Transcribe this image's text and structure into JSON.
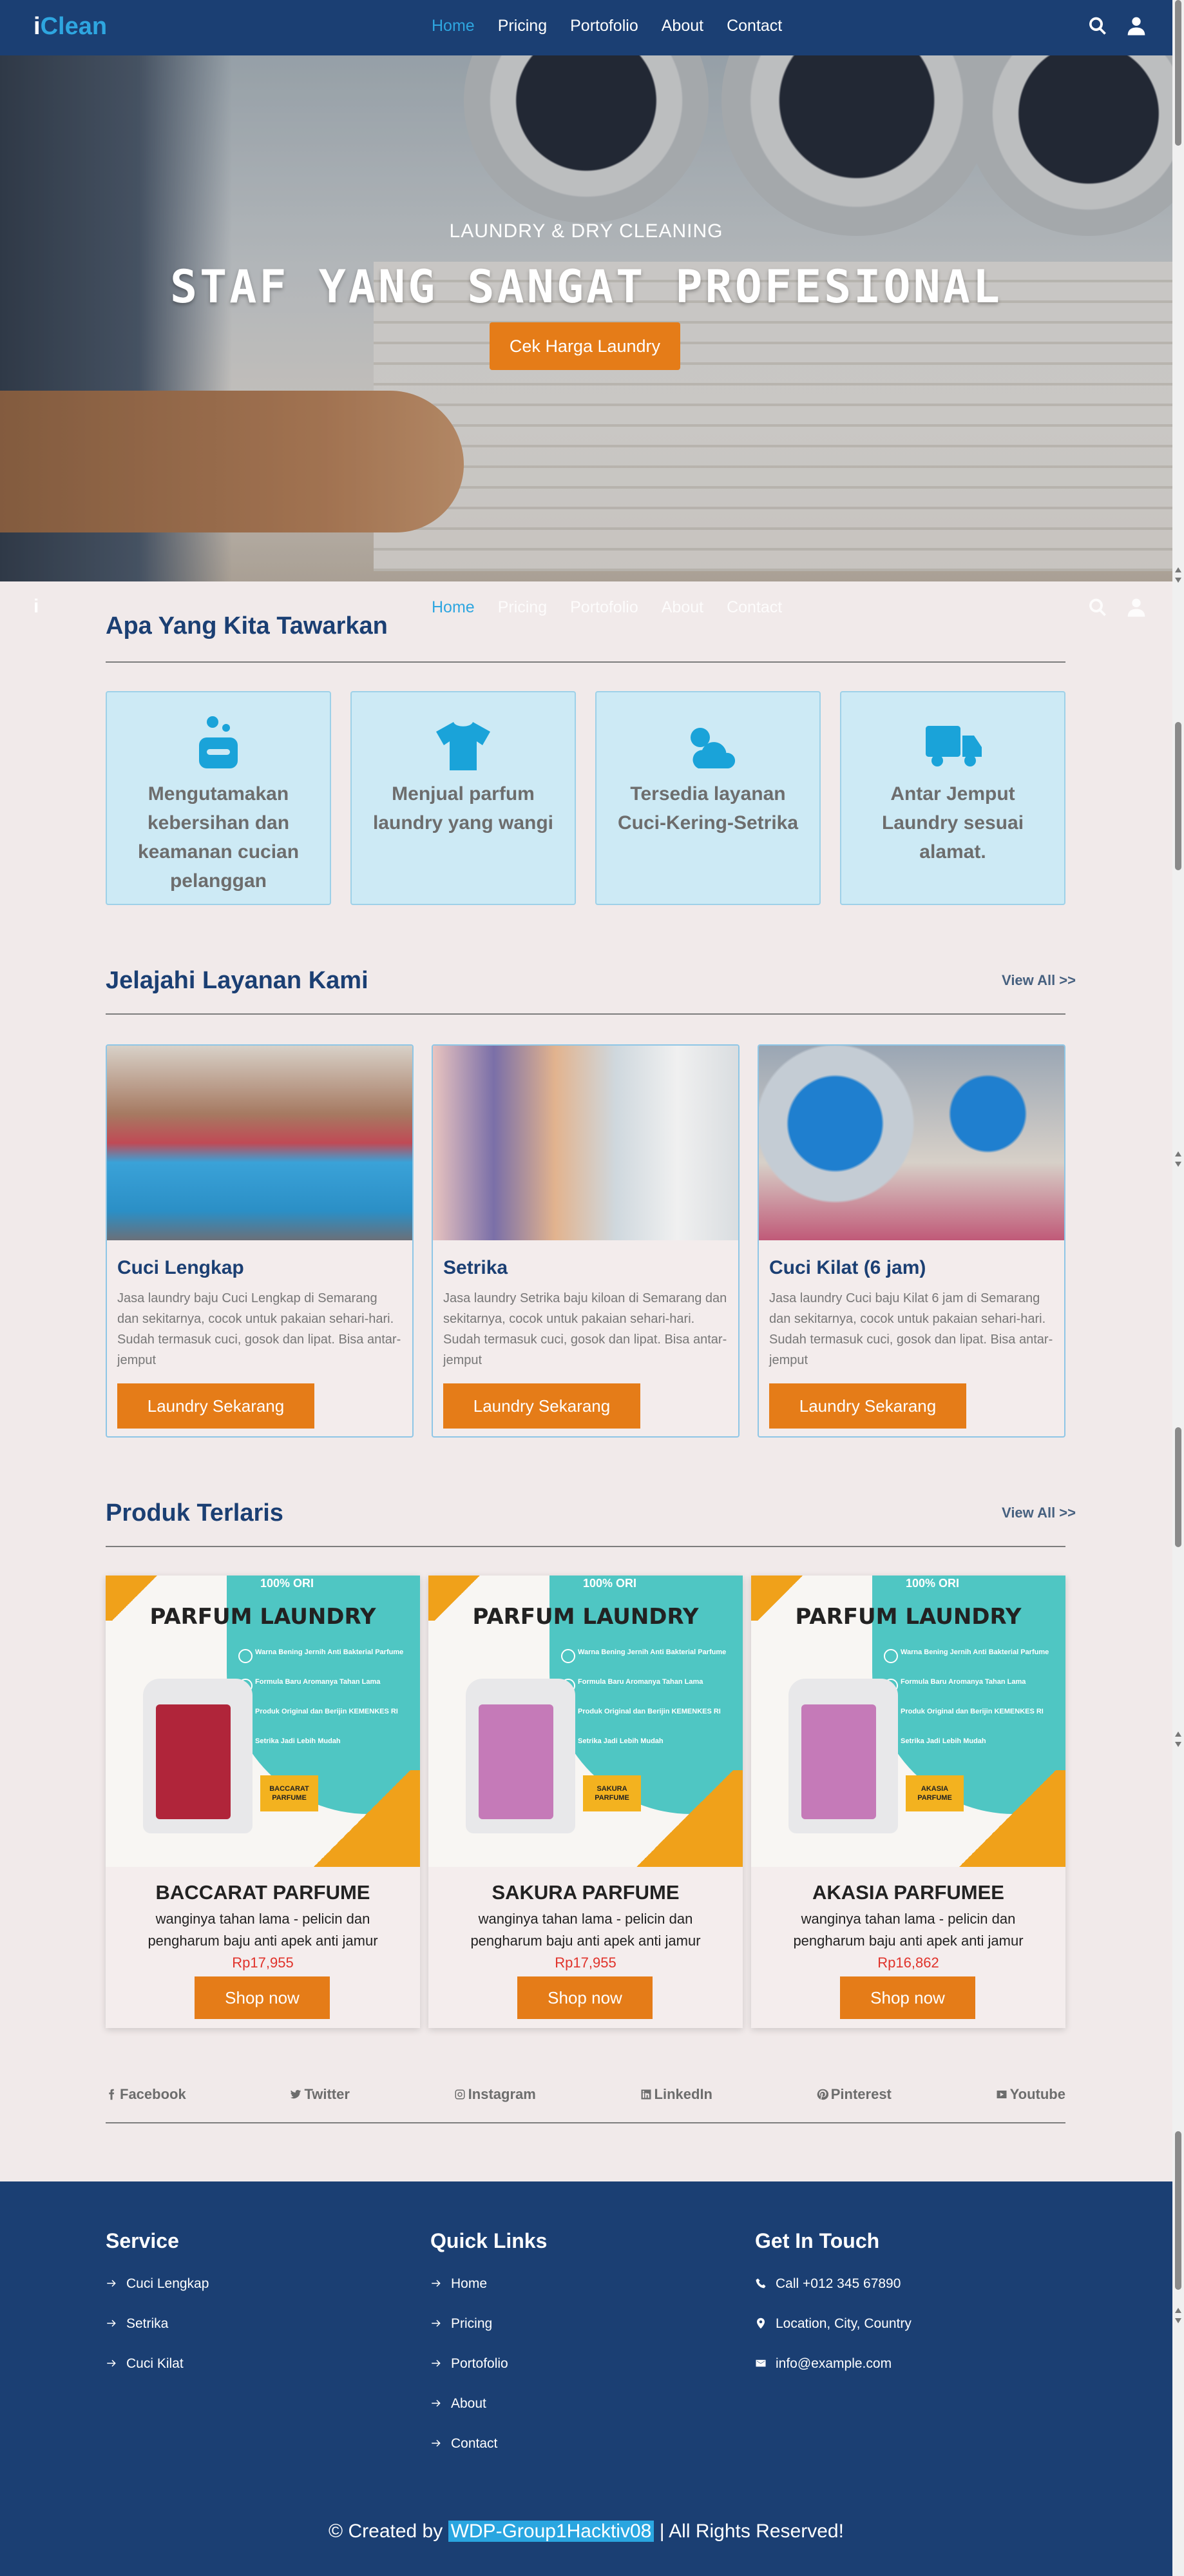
{
  "nav": {
    "logo_i": "i",
    "logo_clean": "Clean",
    "items": [
      "Home",
      "Pricing",
      "Portofolio",
      "About",
      "Contact"
    ],
    "active": "Home"
  },
  "hero": {
    "subtitle": "LAUNDRY & DRY CLEANING",
    "title": "STAF YANG SANGAT PROFESIONAL",
    "button": "Cek Harga Laundry"
  },
  "ghost_nav": {
    "logo": "i"
  },
  "offers": {
    "title": "Apa Yang Kita Tawarkan",
    "cards": [
      {
        "icon": "soap-icon",
        "text": "Mengutamakan kebersihan dan keamanan cucian pelanggan"
      },
      {
        "icon": "tshirt-icon",
        "text": "Menjual parfum laundry yang wangi"
      },
      {
        "icon": "sun-cloud-icon",
        "text": "Tersedia layanan Cuci-Kering-Setrika"
      },
      {
        "icon": "truck-icon",
        "text": "Antar Jemput Laundry sesuai alamat."
      }
    ]
  },
  "services": {
    "title": "Jelajahi Layanan Kami",
    "view_all": "View All >>",
    "cards": [
      {
        "title": "Cuci Lengkap",
        "desc": "Jasa laundry baju Cuci Lengkap di Semarang dan sekitarnya, cocok untuk pakaian sehari-hari. Sudah termasuk cuci, gosok dan lipat. Bisa antar-jemput",
        "button": "Laundry Sekarang"
      },
      {
        "title": "Setrika",
        "desc": "Jasa laundry Setrika baju kiloan di Semarang dan sekitarnya, cocok untuk pakaian sehari-hari. Sudah termasuk cuci, gosok dan lipat. Bisa antar-jemput",
        "button": "Laundry Sekarang"
      },
      {
        "title": "Cuci Kilat (6 jam)",
        "desc": "Jasa laundry Cuci baju Kilat 6 jam di Semarang dan sekitarnya, cocok untuk pakaian sehari-hari. Sudah termasuk cuci, gosok dan lipat. Bisa antar-jemput",
        "button": "Laundry Sekarang"
      }
    ]
  },
  "products": {
    "title": "Produk Terlaris",
    "view_all": "View All >>",
    "image_text": {
      "badge": "100% ORI",
      "heading": "PARFUM LAUNDRY",
      "features": [
        "Warna Bening Jernih Anti Bakterial Parfume",
        "Formula Baru Aromanya Tahan Lama",
        "Produk Original dan Berijin KEMENKES RI",
        "Setrika Jadi Lebih Mudah"
      ]
    },
    "items": [
      {
        "name": "BACCARAT PARFUME",
        "tag": "BACCARAT PARFUME",
        "desc": "wanginya tahan lama - pelicin dan pengharum baju anti apek anti jamur",
        "price": "Rp17,955",
        "button": "Shop now",
        "label_color": "#b0253a"
      },
      {
        "name": "SAKURA PARFUME",
        "tag": "SAKURA PARFUME",
        "desc": "wanginya tahan lama - pelicin dan pengharum baju anti apek anti jamur",
        "price": "Rp17,955",
        "button": "Shop now",
        "label_color": "#c57ab8"
      },
      {
        "name": "AKASIA PARFUMEE",
        "tag": "AKASIA PARFUME",
        "desc": "wanginya tahan lama - pelicin dan pengharum baju anti apek anti jamur",
        "price": "Rp16,862",
        "button": "Shop now",
        "label_color": "#c57ab8"
      }
    ]
  },
  "social": [
    "Facebook",
    "Twitter",
    "Instagram",
    "LinkedIn",
    "Pinterest",
    "Youtube"
  ],
  "footer": {
    "service": {
      "title": "Service",
      "items": [
        "Cuci Lengkap",
        "Setrika",
        "Cuci Kilat"
      ]
    },
    "links": {
      "title": "Quick Links",
      "items": [
        "Home",
        "Pricing",
        "Portofolio",
        "About",
        "Contact"
      ]
    },
    "contact": {
      "title": "Get In Touch",
      "items": [
        "Call +012 345 67890",
        "Location, City, Country",
        "info@example.com"
      ]
    },
    "copyright_prefix": "© Created by",
    "copyright_highlight": "WDP-Group1Hacktiv08",
    "copyright_suffix": "| All Rights Reserved!"
  },
  "colors": {
    "navy": "#1b3f73",
    "accent": "#2ea6e0",
    "orange": "#e57c18",
    "price": "#e0322a",
    "card": "#cdeaf5"
  }
}
